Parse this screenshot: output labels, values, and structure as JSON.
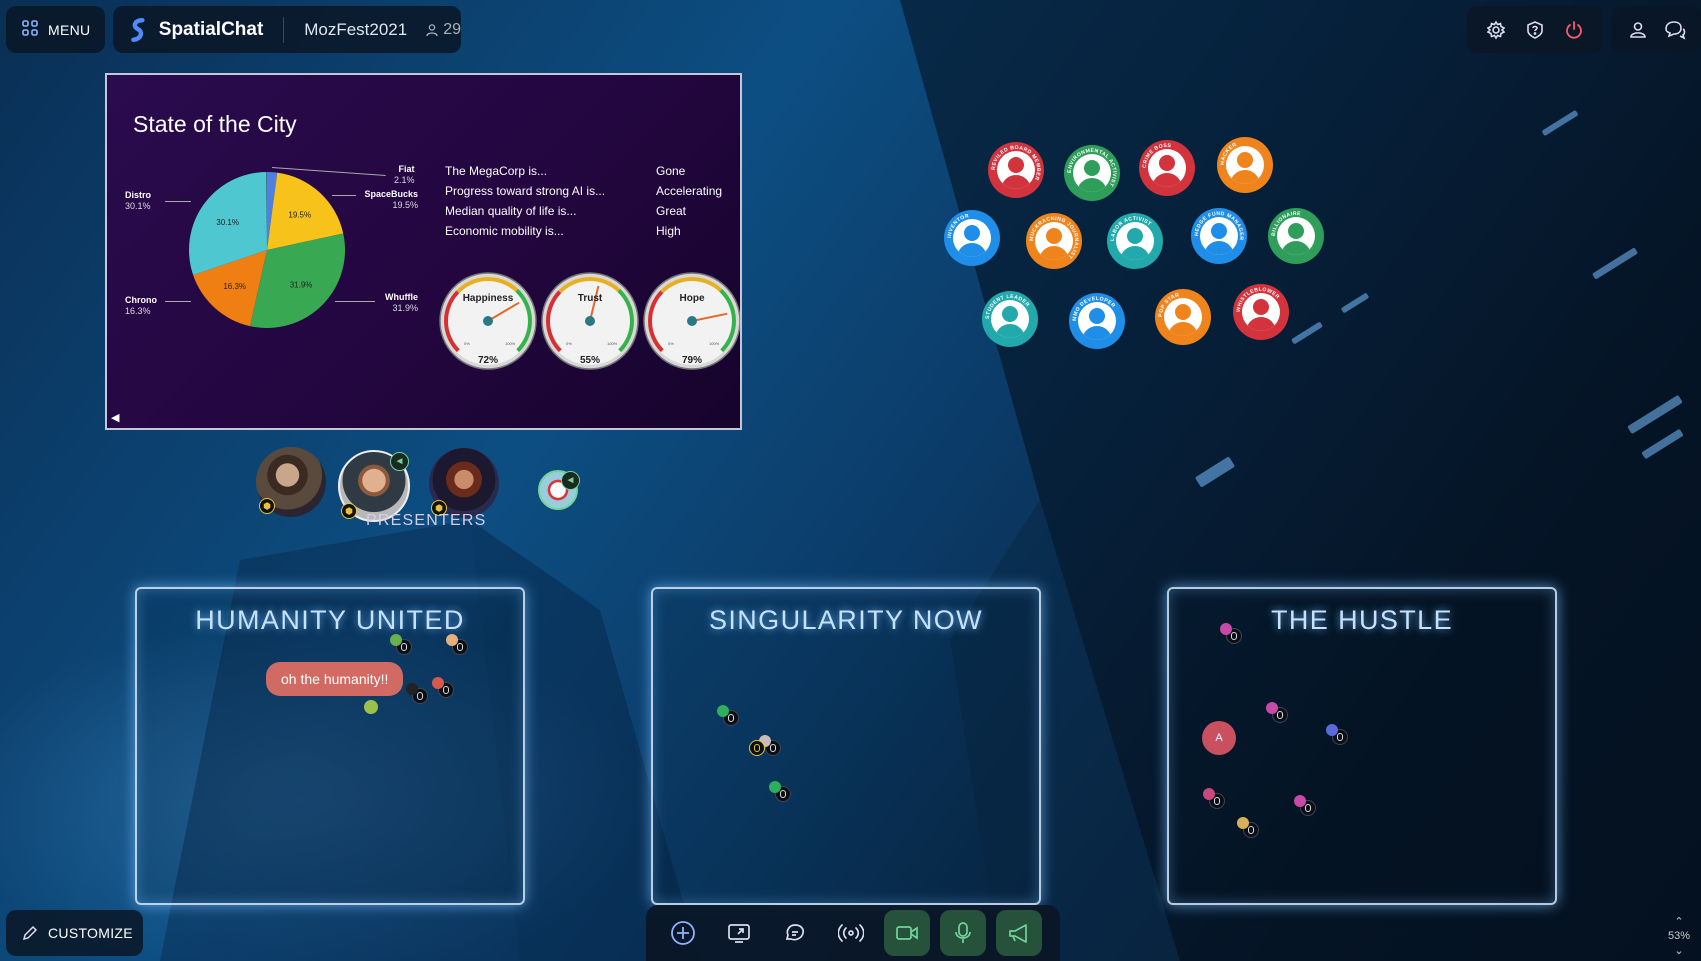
{
  "header": {
    "menu_label": "MENU",
    "brand_name": "SpatialChat",
    "room_name": "MozFest2021",
    "participant_count": "29"
  },
  "top_right": {
    "icons": [
      "settings-icon",
      "help-icon",
      "power-icon",
      "profile-icon",
      "chat-toggle-icon"
    ]
  },
  "slide": {
    "title": "State of the City",
    "pie": {
      "type": "pie",
      "slices": [
        {
          "name": "Fiat",
          "percent": 2.1,
          "color": "#4f7fe0",
          "label": "Fiat",
          "value_label": "2.1%"
        },
        {
          "name": "SpaceBucks",
          "percent": 19.5,
          "color": "#f7c21a",
          "label": "SpaceBucks",
          "value_label": "19.5%"
        },
        {
          "name": "Whuffle",
          "percent": 31.9,
          "color": "#39a852",
          "label": "Whuffle",
          "value_label": "31.9%"
        },
        {
          "name": "Chrono",
          "percent": 16.3,
          "color": "#f07f13",
          "label": "Chrono",
          "value_label": "16.3%"
        },
        {
          "name": "Distro",
          "percent": 30.1,
          "color": "#4ec7d0",
          "label": "Distro",
          "value_label": "30.1%"
        }
      ]
    },
    "stats": [
      {
        "question": "The MegaCorp is...",
        "answer": "Gone"
      },
      {
        "question": "Progress toward strong AI is...",
        "answer": "Accelerating"
      },
      {
        "question": "Median quality of life is...",
        "answer": "Great"
      },
      {
        "question": "Economic mobility is...",
        "answer": "High"
      }
    ],
    "gauges": [
      {
        "name": "Happiness",
        "value": 72,
        "value_label": "72%"
      },
      {
        "name": "Trust",
        "value": 55,
        "value_label": "55%"
      },
      {
        "name": "Hope",
        "value": 79,
        "value_label": "79%"
      }
    ],
    "gauge_scale": {
      "min_label": "0%",
      "max_label": "100%"
    }
  },
  "presenters": {
    "label": "PRESENTERS"
  },
  "role_chips": [
    {
      "label": "REVILED BOARD MEMBER",
      "color": "#d2333d"
    },
    {
      "label": "ENVIRONMENTAL ACTIVIST",
      "color": "#2f9e5b"
    },
    {
      "label": "CRIME BOSS",
      "color": "#d2333d"
    },
    {
      "label": "HACKER",
      "color": "#f0841c"
    },
    {
      "label": "INVENTOR",
      "color": "#1f8ee8"
    },
    {
      "label": "MUCKRACKING JOURNALIST",
      "color": "#f0841c"
    },
    {
      "label": "LABOR ACTIVIST",
      "color": "#21a9ac"
    },
    {
      "label": "HEDGE FUND MANAGER",
      "color": "#1f8ee8"
    },
    {
      "label": "BILLIONAIRE",
      "color": "#2f9e5b"
    },
    {
      "label": "STUDENT LEADER",
      "color": "#21a9ac"
    },
    {
      "label": "MMO DEVELOPER",
      "color": "#1f8ee8"
    },
    {
      "label": "POP STAR",
      "color": "#f0841c"
    },
    {
      "label": "WHISTLEBLOWER",
      "color": "#d2333d"
    }
  ],
  "zones": [
    {
      "title": "HUMANITY UNITED"
    },
    {
      "title": "SINGULARITY NOW"
    },
    {
      "title": "THE HUSTLE"
    }
  ],
  "chat_bubble": {
    "text": "oh the humanity!!"
  },
  "avatar_initial": "A",
  "customize_label": "CUSTOMIZE",
  "toolbar": {
    "icons": [
      "add-icon",
      "screen-share-icon",
      "chat-icon",
      "broadcast-icon",
      "camera-icon",
      "microphone-icon",
      "megaphone-icon"
    ]
  },
  "zoom": {
    "value": "53%"
  },
  "colors": {
    "accent_green": "#73d39a",
    "power_red": "#ff5a6a",
    "panel_bg": "#0a1626",
    "zone_glow": "#78beff"
  }
}
